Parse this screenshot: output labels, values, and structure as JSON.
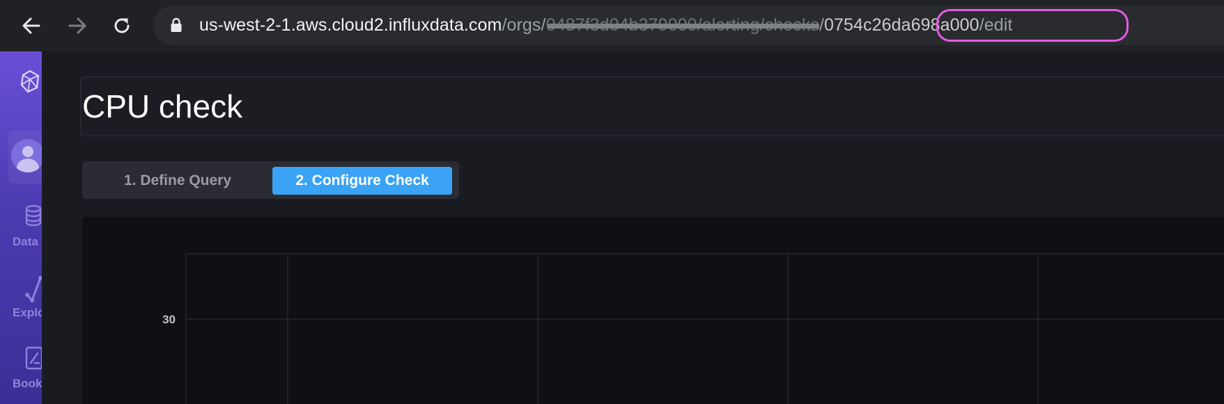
{
  "browser": {
    "url": {
      "host": "us-west-2-1.aws.cloud2.influxdata.com",
      "orgs_segment": "/orgs/",
      "redacted_segment": "0487f3d04b379000/alerting/checks",
      "slash": "/",
      "check_id": "0754c26da698a000",
      "suffix": "/edit"
    }
  },
  "sidebar": {
    "items": [
      {
        "label": "Data",
        "icon": "database-icon"
      },
      {
        "label": "Explore",
        "icon": "graph-icon"
      },
      {
        "label": "Books",
        "icon": "notebook-icon"
      }
    ]
  },
  "check": {
    "title": "CPU check"
  },
  "steps": {
    "define_query": "1. Define Query",
    "configure_check": "2. Configure Check",
    "active": "configure_check"
  },
  "colors": {
    "accent": "#3aa3f5",
    "highlight": "#e65be6",
    "sidebar": "#4b3bb0"
  },
  "chart_data": {
    "type": "line",
    "y_ticks": [
      30
    ],
    "series": []
  }
}
